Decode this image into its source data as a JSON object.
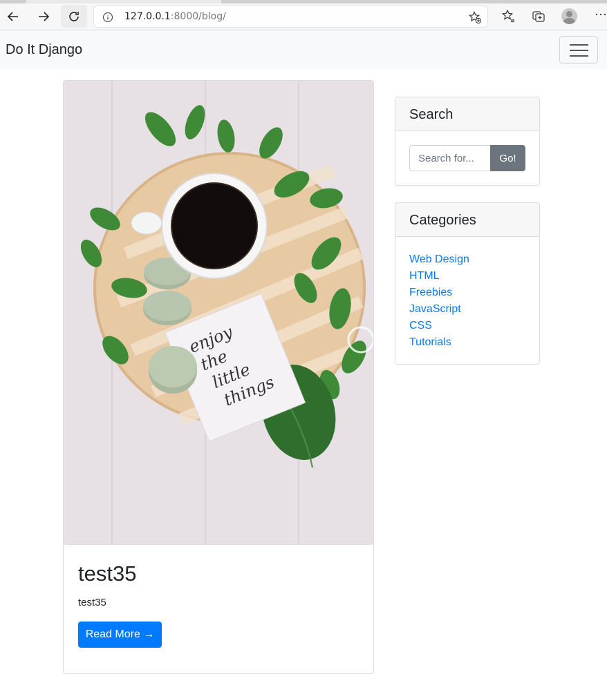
{
  "browser": {
    "url_host": "127.0.0.1",
    "url_rest": ":8000/blog/"
  },
  "navbar": {
    "brand": "Do It Django"
  },
  "post": {
    "title": "test35",
    "excerpt": "test35",
    "read_more": "Read More →",
    "image_text": [
      "enjoy",
      "the",
      "little",
      "things"
    ]
  },
  "search": {
    "title": "Search",
    "placeholder": "Search for...",
    "button": "Go!"
  },
  "categories": {
    "title": "Categories",
    "items": [
      "Web Design",
      "HTML",
      "Freebies",
      "JavaScript",
      "CSS",
      "Tutorials"
    ]
  },
  "colors": {
    "primary": "#007bff",
    "secondary": "#6c757d",
    "navbar_bg": "#f8f9fa"
  }
}
